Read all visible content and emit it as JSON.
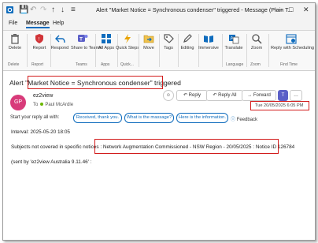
{
  "window": {
    "title": "Alert \"Market Notice = Synchronous condenser\" triggered - Message (Plain T..."
  },
  "menu": {
    "items": [
      "File",
      "Message",
      "Help"
    ],
    "active": "Message"
  },
  "ribbon": {
    "buttons": {
      "delete": "Delete",
      "report": "Report",
      "respond": "Respond",
      "share_teams": "Share to Teams",
      "all_apps": "All Apps",
      "quick_steps": "Quick Steps",
      "move": "Move",
      "tags": "Tags",
      "editing": "Editing",
      "immersive": "Immersive",
      "translate": "Translate",
      "zoom": "Zoom",
      "reply_scheduling": "Reply with Scheduling P..."
    },
    "groups": {
      "delete": "Delete",
      "report": "Report",
      "teams": "Teams",
      "apps": "Apps",
      "quick": "Quick...",
      "language": "Language",
      "zoom": "Zoom",
      "find_time": "Find Time"
    }
  },
  "email": {
    "subject_prefix": "Alert ",
    "subject_quoted": "\"Market Notice = Synchronous condenser\"",
    "subject_suffix": " triggered",
    "avatar_initials": "GP",
    "sender": "ez2view",
    "to_label": "To",
    "recipient": "Paul McArdle",
    "date": "Tue 20/05/2025 6:05 PM",
    "actions": {
      "reply": "Reply",
      "reply_all": "Reply All",
      "forward": "Forward"
    },
    "reply_with_label": "Start your reply all with:",
    "suggestions": [
      "Received, thank you.",
      "What is the massage?",
      "Here is the information."
    ],
    "feedback": "Feedback",
    "body": {
      "interval": "Interval: 2025-05-20 18:05",
      "subjects_label": "Subjects not covered in specific notices : ",
      "notice": "Network Augmentation Commissioned - NSW Region - 20/05/2025 : Notice ID 126784",
      "sent_by": "(sent by 'ez2view Australia 9.11.46' :"
    }
  },
  "colors": {
    "accent": "#0f6cbd",
    "highlight_box": "#d21b1b",
    "avatar_bg": "#d83b7a"
  }
}
